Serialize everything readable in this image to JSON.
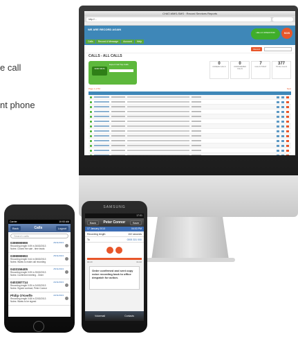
{
  "side_text": {
    "line1": "e call",
    "line2": "nt phone"
  },
  "imac": {
    "window_title": "CHAT-MMS-SMS · Record Services Reports",
    "url": "http://...",
    "logo": "WE ARE RECORD AGAIN",
    "hello_text": "HELLO OPERATOR",
    "sos": "SOS",
    "nav_tabs": [
      "Calls",
      "Record A Message",
      "Account",
      "Help"
    ],
    "record_button": "Record",
    "calls_title": "CALLS - ALL CALLS",
    "badge": "3000 MINS",
    "card_labels": [
      "Expert Call",
      "Top Calls"
    ],
    "stats": [
      {
        "num": "0",
        "label": "UNREAD CALLS"
      },
      {
        "num": "0",
        "label": "UNANSWERED CALLS"
      },
      {
        "num": "7",
        "label": "CALLS TODAY"
      },
      {
        "num": "377",
        "label": "TOTAL CALLS"
      }
    ],
    "pagination_left": "Page 1 of 52",
    "pagination_right": "Next"
  },
  "iphone": {
    "status_left": "Carrier",
    "status_time": "10:53 AM",
    "back": "Back",
    "title": "Calls",
    "logout": "Logout",
    "search_placeholder": "Search calls",
    "calls": [
      {
        "number": "0399999999",
        "date": "26/11/2013",
        "duration": "Recording length 0:09 in 26/02/2013",
        "note": "Notes: Closed the sale - time leads"
      },
      {
        "number": "0399999993",
        "date": "25/11/2013",
        "duration": "Recording length 0:44 in 08/02/2013",
        "note": "Notes: Wants to make call recording"
      },
      {
        "number": "0433156405",
        "date": "25/11/2013",
        "duration": "Recording length 0:09 in 25/02/2013",
        "note": "Notes: Confirmed meeting - Order"
      },
      {
        "number": "0403387714",
        "date": "24/11/2013",
        "duration": "Recording length 0:25 in 24/02/2013",
        "note": "Notes: Signed contract, Peter Connor"
      },
      {
        "number": "Philip O'Keeffe",
        "date": "22/11/2013",
        "duration": "Recording length 0:08 in 22/02/2013",
        "note": "Notes: Wants to be signed"
      }
    ]
  },
  "samsung": {
    "brand": "SAMSUNG",
    "status_time": "17:01",
    "back": "Back",
    "title": "Peter Connor",
    "save": "Save",
    "date": "17 January 2013",
    "time": "04:03 PM",
    "recording_label": "Recording length",
    "recording_value": "102 seconds",
    "to_label": "To",
    "to_value": "0393 331 000",
    "time_left": "00:20",
    "time_right": "01:42",
    "note": "Order confirmed and sent copy voice recording back to office despatch for action.",
    "tabs": [
      "Voicemail",
      "Contacts"
    ]
  }
}
